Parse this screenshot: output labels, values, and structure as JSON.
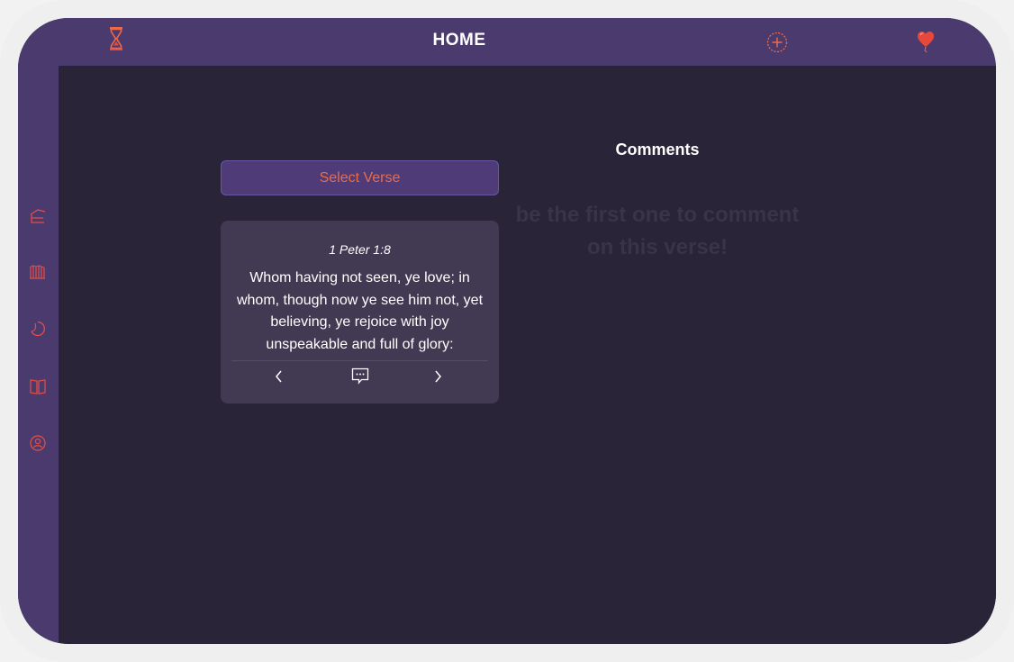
{
  "header": {
    "title": "HOME",
    "icons": [
      "hourglass-icon",
      "add-circle-icon",
      "heart-balloon-icon"
    ]
  },
  "sidebar": {
    "items": [
      {
        "icon": "home-icon"
      },
      {
        "icon": "library-icon"
      },
      {
        "icon": "moon-icon"
      },
      {
        "icon": "book-icon"
      },
      {
        "icon": "profile-icon"
      }
    ]
  },
  "verse": {
    "select_label": "Select Verse",
    "reference": "1 Peter 1:8",
    "text": "Whom having not seen, ye love; in whom, though now ye see him not, yet believing, ye rejoice with joy unspeakable and full of glory:"
  },
  "comments": {
    "title": "Comments",
    "empty_message": "be the first one to comment on this verse!"
  },
  "colors": {
    "bar": "#4b3a6e",
    "background": "#292437",
    "card": "#423a52",
    "accent": "#ee6a46",
    "muted_text": "#3a3447"
  }
}
